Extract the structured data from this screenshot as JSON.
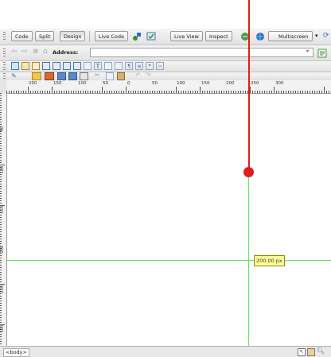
{
  "document_toolbar": {
    "code": "Code",
    "split": "Split",
    "design": "Design",
    "live_code": "Live Code",
    "live_view": "Live View",
    "inspect": "Inspect",
    "multiscreen": "Multiscreen"
  },
  "address_bar": {
    "label": "Address:",
    "value": ""
  },
  "icons": {
    "back": "back-arrow-icon",
    "forward": "forward-arrow-icon",
    "stop": "stop-icon",
    "home": "home-icon"
  },
  "ruler": {
    "h_labels": [
      "200",
      "150",
      "100",
      "50",
      "0",
      "50",
      "100",
      "150",
      "200",
      "250",
      "300"
    ],
    "v_labels": [
      "50",
      "100",
      "150",
      "200",
      "250",
      "300"
    ]
  },
  "guide_tooltip": "200.00 px",
  "status_bar": {
    "tag": "<body>"
  },
  "colors": {
    "guide": "#5ae85a",
    "annotation": "#e21b1b",
    "tooltip_bg": "#ffff99"
  }
}
